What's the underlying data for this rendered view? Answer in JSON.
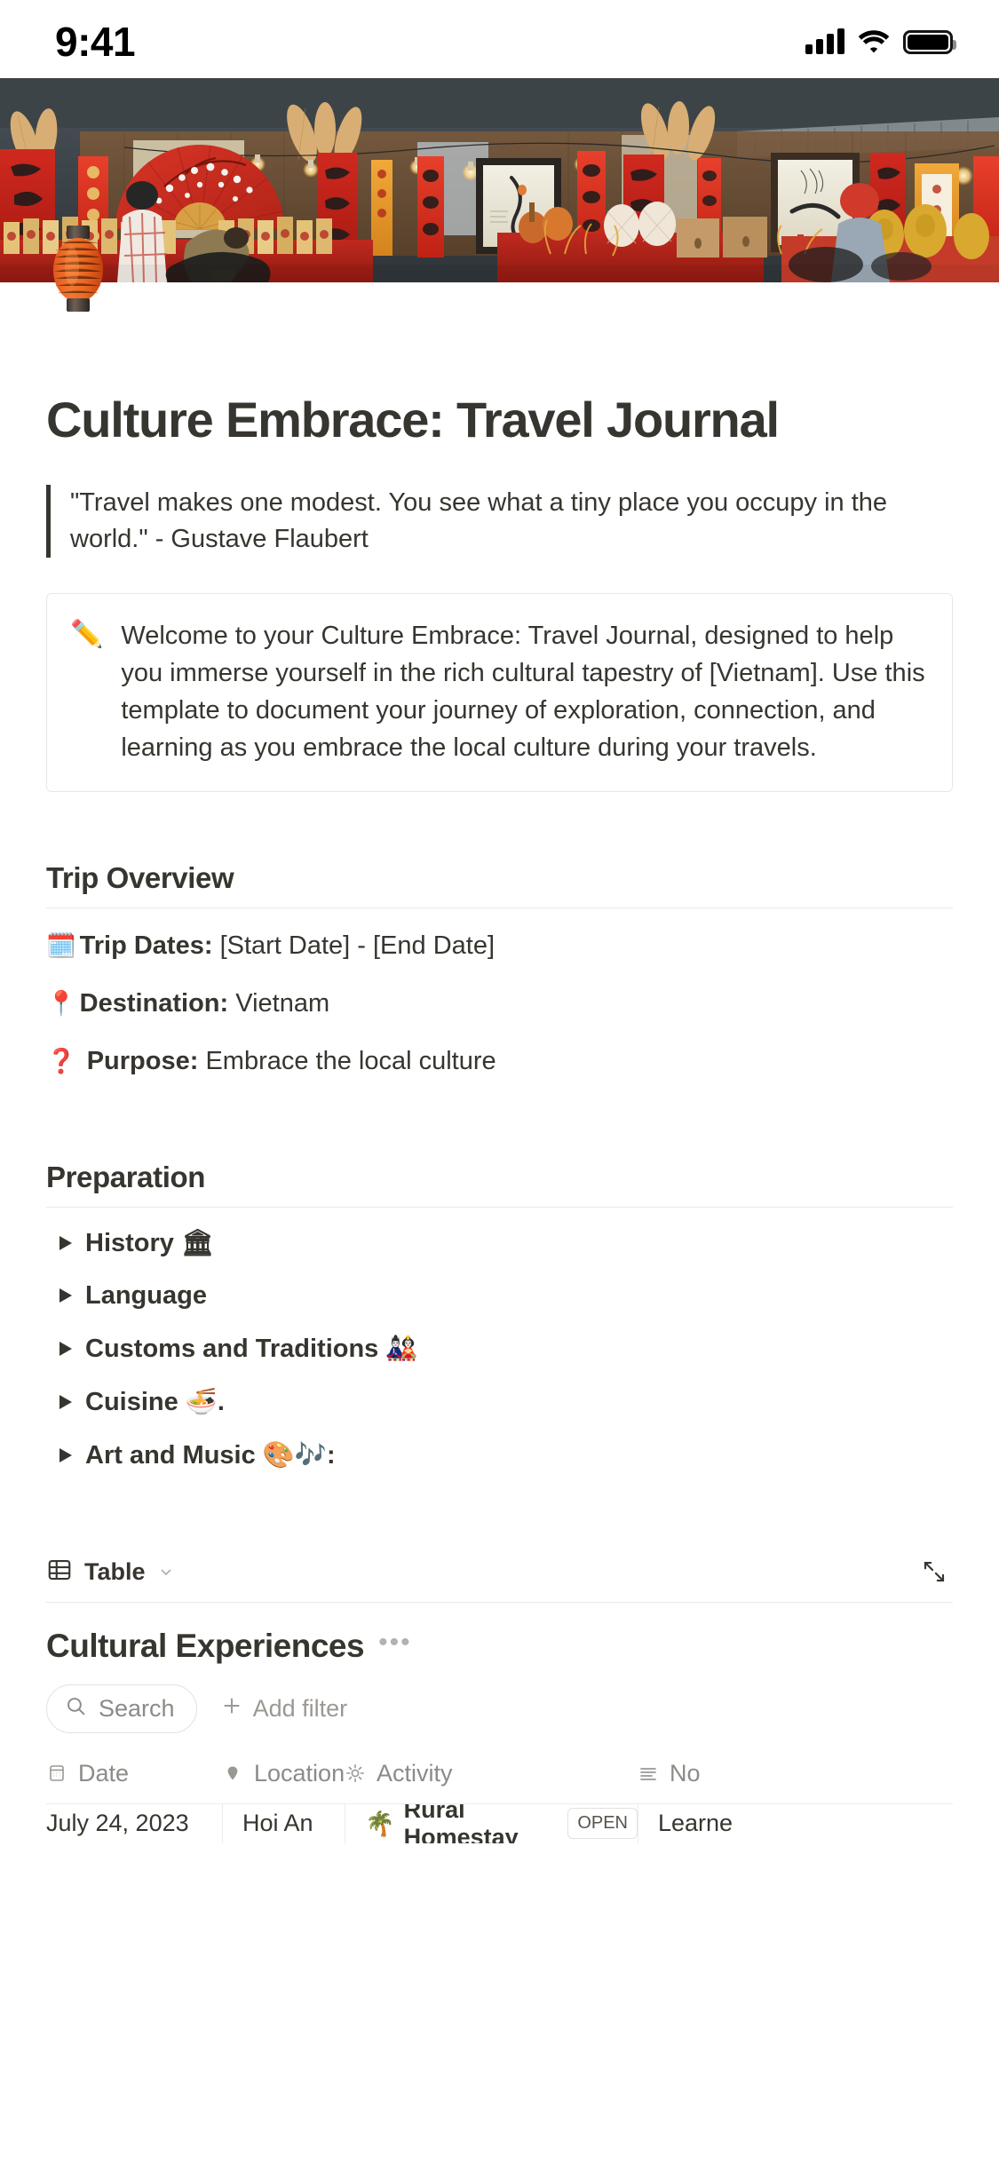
{
  "status_bar": {
    "time": "9:41",
    "signal_icon": "cellular-bars-icon",
    "wifi_icon": "wifi-icon",
    "battery_icon": "battery-full-icon"
  },
  "cover": {
    "alt": "Vietnamese Tet market with red calligraphy banners and lanterns"
  },
  "page": {
    "icon": "🏮",
    "icon_name": "red-paper-lantern-icon",
    "title": "Culture Embrace: Travel Journal",
    "quote": "\"Travel makes one modest. You see what a tiny place you occupy in the world.\" - Gustave Flaubert",
    "callout": {
      "emoji": "✏️",
      "emoji_name": "pencil-icon",
      "text": "Welcome to your Culture Embrace: Travel Journal, designed to help you immerse yourself in the rich cultural tapestry of [Vietnam]. Use this template to document your journey of exploration, connection, and learning as you embrace the local culture during your travels."
    }
  },
  "trip_overview": {
    "heading": "Trip Overview",
    "rows": [
      {
        "emoji": "🗓️",
        "emoji_name": "calendar-icon",
        "label": "Trip Dates:",
        "value": "[Start Date] - [End Date]"
      },
      {
        "emoji": "📍",
        "emoji_name": "map-pin-icon",
        "label": "Destination:",
        "value": "Vietnam"
      },
      {
        "emoji": "❓",
        "emoji_name": "question-mark-icon",
        "label": "Purpose:",
        "value": "Embrace the local culture"
      }
    ]
  },
  "preparation": {
    "heading": "Preparation",
    "toggles": [
      {
        "label": "History 🏛",
        "icon": "toggle-arrow-icon"
      },
      {
        "label": "Language",
        "icon": "toggle-arrow-icon"
      },
      {
        "label": "Customs and Traditions 🎎",
        "icon": "toggle-arrow-icon"
      },
      {
        "label": "Cuisine 🍜.",
        "icon": "toggle-arrow-icon"
      },
      {
        "label": "Art and Music 🎨🎶:",
        "icon": "toggle-arrow-icon"
      }
    ]
  },
  "database": {
    "view_icon": "table-grid-icon",
    "view_label": "Table",
    "view_chevron": "chevron-down-icon",
    "expand_icon": "expand-arrows-icon",
    "title": "Cultural Experiences",
    "more_icon": "ellipsis-icon",
    "search_label": "Search",
    "search_icon": "search-icon",
    "add_filter_label": "Add filter",
    "add_filter_icon": "plus-icon",
    "columns": [
      {
        "label": "Date",
        "icon": "calendar-property-icon"
      },
      {
        "label": "Location",
        "icon": "map-pin-property-icon"
      },
      {
        "label": "Activity",
        "icon": "sun-property-icon"
      },
      {
        "label": "No",
        "icon": "text-lines-property-icon"
      }
    ],
    "rows": [
      {
        "date": "July 24, 2023",
        "location": "Hoi An",
        "activity_emoji": "🌴",
        "activity": "Rural Homestay",
        "tag": "OPEN",
        "notes": "Learne"
      }
    ]
  }
}
